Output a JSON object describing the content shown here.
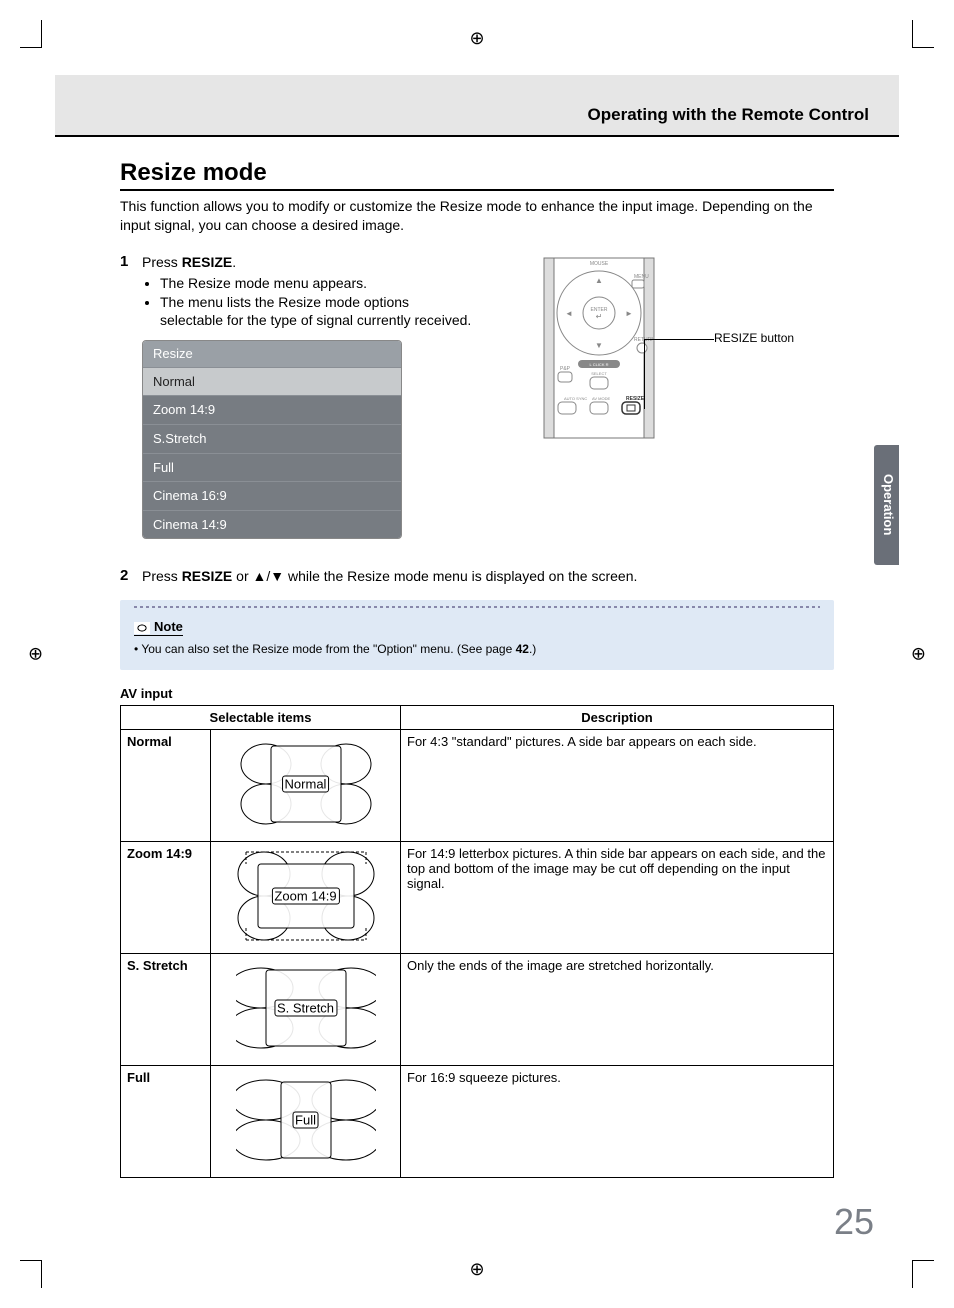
{
  "header": {
    "title": "Operating with the Remote Control"
  },
  "section": {
    "heading": "Resize mode",
    "intro": "This function allows you to modify or customize the Resize mode to enhance the input image. Depending on the input signal, you can choose a desired image."
  },
  "steps": {
    "one_num": "1",
    "one_text_a": "Press ",
    "one_text_b": "RESIZE",
    "one_text_c": ".",
    "one_bullet1": "The Resize mode menu appears.",
    "one_bullet2": "The menu lists the Resize mode options selectable for the type of signal currently received.",
    "two_num": "2",
    "two_text_a": "Press ",
    "two_text_b": "RESIZE",
    "two_text_c": " or ▲/▼ while the Resize mode menu is displayed on the screen."
  },
  "menu": {
    "header": "Resize",
    "items": [
      "Normal",
      "Zoom 14:9",
      "S.Stretch",
      "Full",
      "Cinema 16:9",
      "Cinema 14:9"
    ],
    "selected_index": 0
  },
  "remote": {
    "callout": "RESIZE button",
    "labels": {
      "mouse": "MOUSE",
      "menu": "MENU",
      "enter": "ENTER",
      "return": "RETURN",
      "pap": "P&P",
      "lclick": "L CLICK R",
      "select": "SELECT",
      "autosync": "AUTO SYNC",
      "avmode": "AV MODE",
      "resize": "RESIZE"
    }
  },
  "note": {
    "label": "Note",
    "text_a": "• You can also set the Resize mode from the \"Option\" menu. (See page ",
    "text_b": "42",
    "text_c": ".)"
  },
  "av": {
    "heading": "AV input",
    "col1": "Selectable items",
    "col2": "Description",
    "rows": [
      {
        "name": "Normal",
        "illus_label": "Normal",
        "desc": "For 4:3 \"standard\" pictures. A side bar appears on each side."
      },
      {
        "name": "Zoom 14:9",
        "illus_label": "Zoom 14:9",
        "desc": "For 14:9 letterbox pictures. A thin side bar appears on each side, and the top and bottom of the image may be cut off depending on the input signal."
      },
      {
        "name": "S. Stretch",
        "illus_label": "S. Stretch",
        "desc": "Only the ends of the image are stretched horizontally."
      },
      {
        "name": "Full",
        "illus_label": "Full",
        "desc": "For 16:9 squeeze pictures."
      }
    ]
  },
  "sidetab": "Operation",
  "page_number": "25"
}
